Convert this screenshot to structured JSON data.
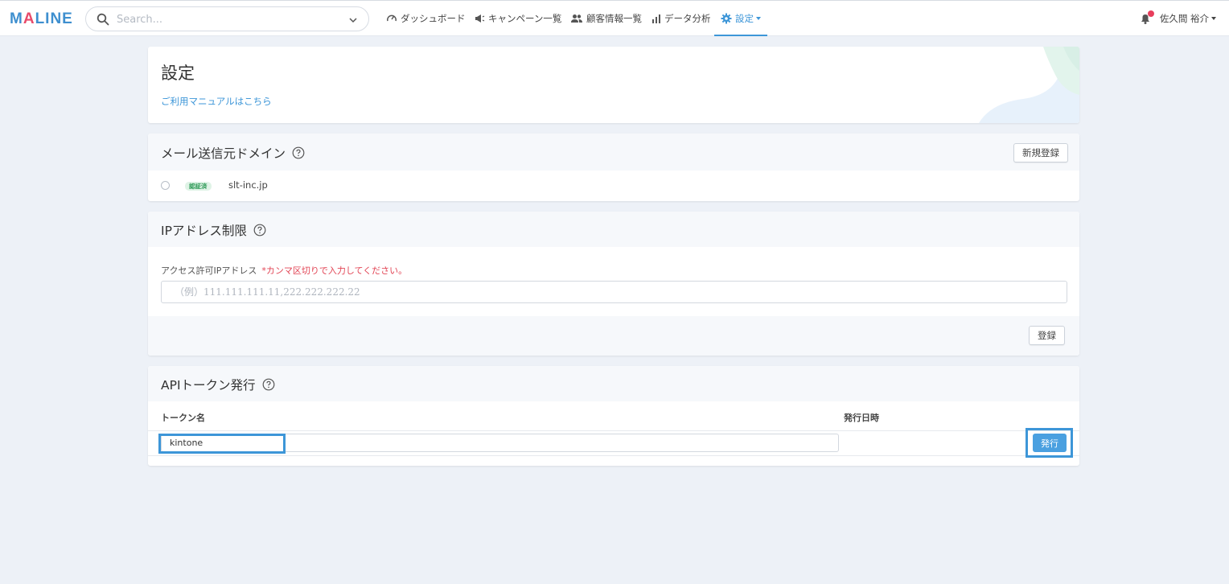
{
  "app": {
    "logo_text_prefix": "M",
    "logo_text_accent": "A",
    "logo_text_suffix": "LINE",
    "accent_color": "#3d96d8"
  },
  "search": {
    "placeholder": "Search..."
  },
  "nav": {
    "items": [
      {
        "label": "ダッシュボード",
        "icon": "speedometer-icon"
      },
      {
        "label": "キャンペーン一覧",
        "icon": "megaphone-icon"
      },
      {
        "label": "顧客情報一覧",
        "icon": "users-icon"
      },
      {
        "label": "データ分析",
        "icon": "bar-chart-icon"
      },
      {
        "label": "設定",
        "icon": "gear-icon",
        "active": true
      }
    ]
  },
  "user": {
    "name": "佐久間 裕介",
    "notification": true
  },
  "settings": {
    "title": "設定",
    "manual_link": "ご利用マニュアルはこちら"
  },
  "mail_domain": {
    "title": "メール送信元ドメイン",
    "new_button": "新規登録",
    "rows": [
      {
        "badge": "認証済",
        "domain": "slt-inc.jp",
        "selected": false
      }
    ]
  },
  "ip_restriction": {
    "title": "IPアドレス制限",
    "field_label": "アクセス許可IPアドレス",
    "field_note": "*カンマ区切りで入力してください。",
    "placeholder": "（例）111.111.111.11,222.222.222.22",
    "value": "",
    "submit_button": "登録"
  },
  "api_token": {
    "title": "APIトークン発行",
    "columns": [
      "トークン名",
      "発行日時"
    ],
    "row": {
      "token_name": "kintone",
      "issued_at": ""
    },
    "issue_button": "発行"
  }
}
